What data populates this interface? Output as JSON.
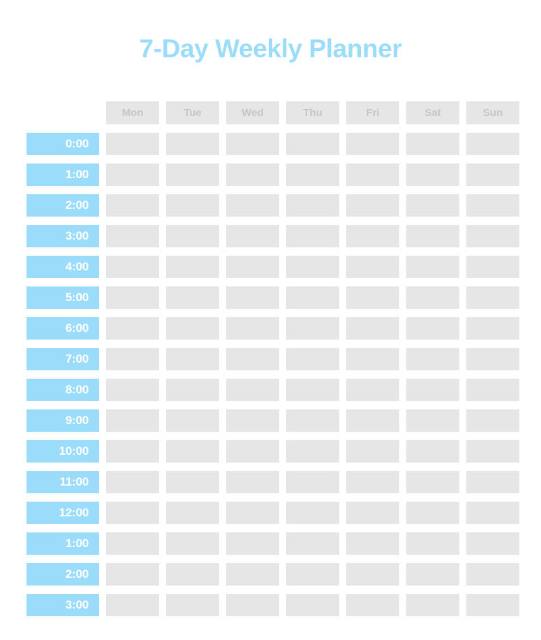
{
  "page": {
    "title": "7-Day Weekly Planner",
    "background_color": "#ffffff",
    "accent_color": "#9CDCFB",
    "slot_color": "#E6E6E6",
    "header_text_color": "#C6C6C6"
  },
  "columns": [
    {
      "label": "Mon"
    },
    {
      "label": "Tue"
    },
    {
      "label": "Wed"
    },
    {
      "label": "Thu"
    },
    {
      "label": "Fri"
    },
    {
      "label": "Sat"
    },
    {
      "label": "Sun"
    }
  ],
  "rows": [
    {
      "time": "0:00"
    },
    {
      "time": "1:00"
    },
    {
      "time": "2:00"
    },
    {
      "time": "3:00"
    },
    {
      "time": "4:00"
    },
    {
      "time": "5:00"
    },
    {
      "time": "6:00"
    },
    {
      "time": "7:00"
    },
    {
      "time": "8:00"
    },
    {
      "time": "9:00"
    },
    {
      "time": "10:00"
    },
    {
      "time": "11:00"
    },
    {
      "time": "12:00"
    },
    {
      "time": "1:00"
    },
    {
      "time": "2:00"
    },
    {
      "time": "3:00"
    }
  ],
  "cells": [
    [
      "",
      "",
      "",
      "",
      "",
      "",
      ""
    ],
    [
      "",
      "",
      "",
      "",
      "",
      "",
      ""
    ],
    [
      "",
      "",
      "",
      "",
      "",
      "",
      ""
    ],
    [
      "",
      "",
      "",
      "",
      "",
      "",
      ""
    ],
    [
      "",
      "",
      "",
      "",
      "",
      "",
      ""
    ],
    [
      "",
      "",
      "",
      "",
      "",
      "",
      ""
    ],
    [
      "",
      "",
      "",
      "",
      "",
      "",
      ""
    ],
    [
      "",
      "",
      "",
      "",
      "",
      "",
      ""
    ],
    [
      "",
      "",
      "",
      "",
      "",
      "",
      ""
    ],
    [
      "",
      "",
      "",
      "",
      "",
      "",
      ""
    ],
    [
      "",
      "",
      "",
      "",
      "",
      "",
      ""
    ],
    [
      "",
      "",
      "",
      "",
      "",
      "",
      ""
    ],
    [
      "",
      "",
      "",
      "",
      "",
      "",
      ""
    ],
    [
      "",
      "",
      "",
      "",
      "",
      "",
      ""
    ],
    [
      "",
      "",
      "",
      "",
      "",
      "",
      ""
    ],
    [
      "",
      "",
      "",
      "",
      "",
      "",
      ""
    ]
  ]
}
